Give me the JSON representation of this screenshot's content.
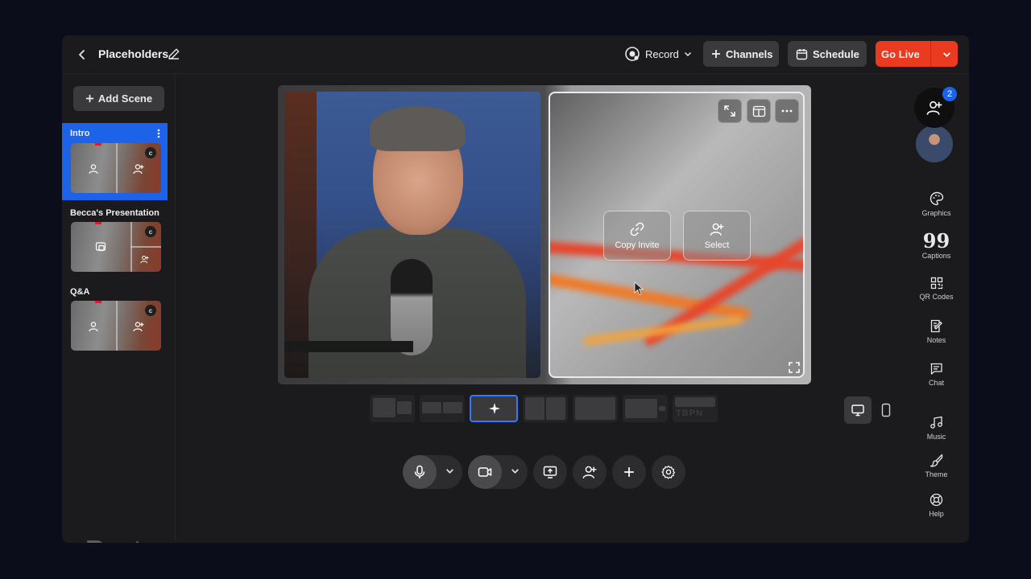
{
  "header": {
    "title": "Placeholders",
    "record_label": "Record",
    "channels_label": "Channels",
    "schedule_label": "Schedule",
    "golive_label": "Go Live"
  },
  "sidebar": {
    "add_scene_label": "Add Scene",
    "scenes": [
      {
        "label": "Intro",
        "badge": "c",
        "active": true
      },
      {
        "label": "Becca's Presentation",
        "badge": "c",
        "active": false
      },
      {
        "label": "Q&A",
        "badge": "c",
        "active": false
      }
    ]
  },
  "brand": {
    "watermark": "Restream"
  },
  "stage": {
    "guest_actions": {
      "copy_invite": "Copy Invite",
      "select": "Select"
    }
  },
  "layouts": {
    "selected_index": 2,
    "last_label": "TBPN"
  },
  "rightbar": {
    "guest_count": "2",
    "tools": [
      "Graphics",
      "Captions",
      "QR Codes",
      "Notes",
      "Chat",
      "Music",
      "Theme",
      "Help"
    ]
  },
  "colors": {
    "accent": "#1d63ea",
    "golive": "#ea3a1f",
    "background": "#0b0e1a",
    "panel": "#1b1b1d"
  }
}
